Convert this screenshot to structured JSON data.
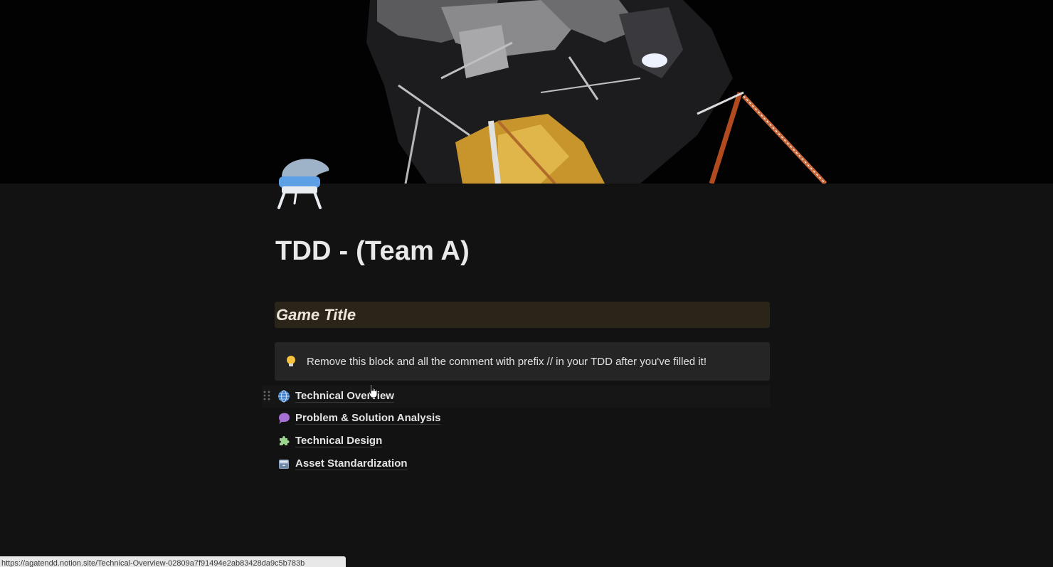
{
  "cover": {
    "description_icon": "lunar-module-cover-image"
  },
  "page": {
    "icon": "ufo-chair-icon",
    "title": "TDD - (Team A)"
  },
  "heading": {
    "text": "Game Title"
  },
  "callout": {
    "icon": "lightbulb-icon",
    "text": "Remove this block and all the comment with prefix // in your TDD after you've filled it!"
  },
  "links": [
    {
      "icon": "globe-icon",
      "label": "Technical Overview"
    },
    {
      "icon": "speech-bubble-icon",
      "label": "Problem & Solution Analysis"
    },
    {
      "icon": "puzzle-icon",
      "label": "Technical Design"
    },
    {
      "icon": "card-file-box-icon",
      "label": "Asset Standardization"
    }
  ],
  "status_bar": {
    "url": "https://agatendd.notion.site/Technical-Overview-02809a7f91494e2ab83428da9c5b783b"
  },
  "colors": {
    "background": "#121212",
    "heading_bg": "#2b2419",
    "callout_bg": "#252525"
  }
}
